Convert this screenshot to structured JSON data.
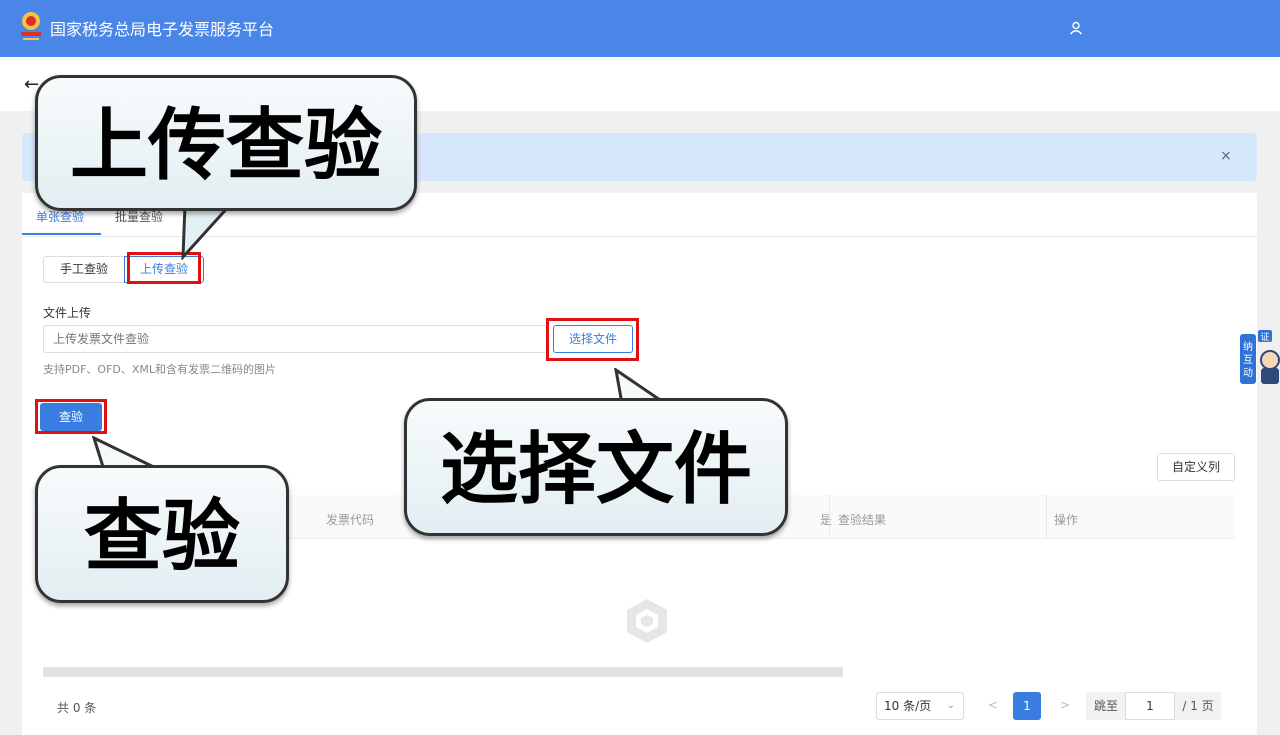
{
  "header": {
    "app_title": "国家税务总局电子发票服务平台",
    "logo_icon": "tax-emblem-icon",
    "user_icon": "user-icon",
    "bg_color": "#4a86e8"
  },
  "nav": {
    "back_icon": "back-arrow-icon",
    "back_glyph": "←"
  },
  "banner": {
    "close_glyph": "×"
  },
  "tabs": [
    {
      "label": "单张查验",
      "active": true
    },
    {
      "label": "批量查验",
      "active": false
    }
  ],
  "mode_switch": {
    "manual_label": "手工查验",
    "upload_label": "上传查验",
    "selected": "上传查验"
  },
  "upload": {
    "field_label": "文件上传",
    "placeholder": "上传发票文件查验",
    "choose_button": "选择文件",
    "hint": "支持PDF、OFD、XML和含有发票二维码的图片"
  },
  "check_button": "查验",
  "table": {
    "custom_columns_button": "自定义列",
    "headers": [
      "发票代码",
      "是",
      "查验结果",
      "操作"
    ],
    "empty_icon": "empty-box-icon"
  },
  "pagination": {
    "total_text": "共 0 条",
    "page_size": "10 条/页",
    "prev_glyph": "<",
    "next_glyph": ">",
    "current_page": "1",
    "goto_label": "跳至",
    "goto_value": "1",
    "total_pages": "/ 1 页"
  },
  "side_widget": {
    "line1": "纳",
    "line2": "互",
    "line3": "动",
    "badge": "证"
  },
  "callouts": {
    "upload_check": "上传查验",
    "choose_file": "选择文件",
    "check": "查验"
  },
  "colors": {
    "accent": "#3a7de0",
    "highlight": "#e01010"
  }
}
